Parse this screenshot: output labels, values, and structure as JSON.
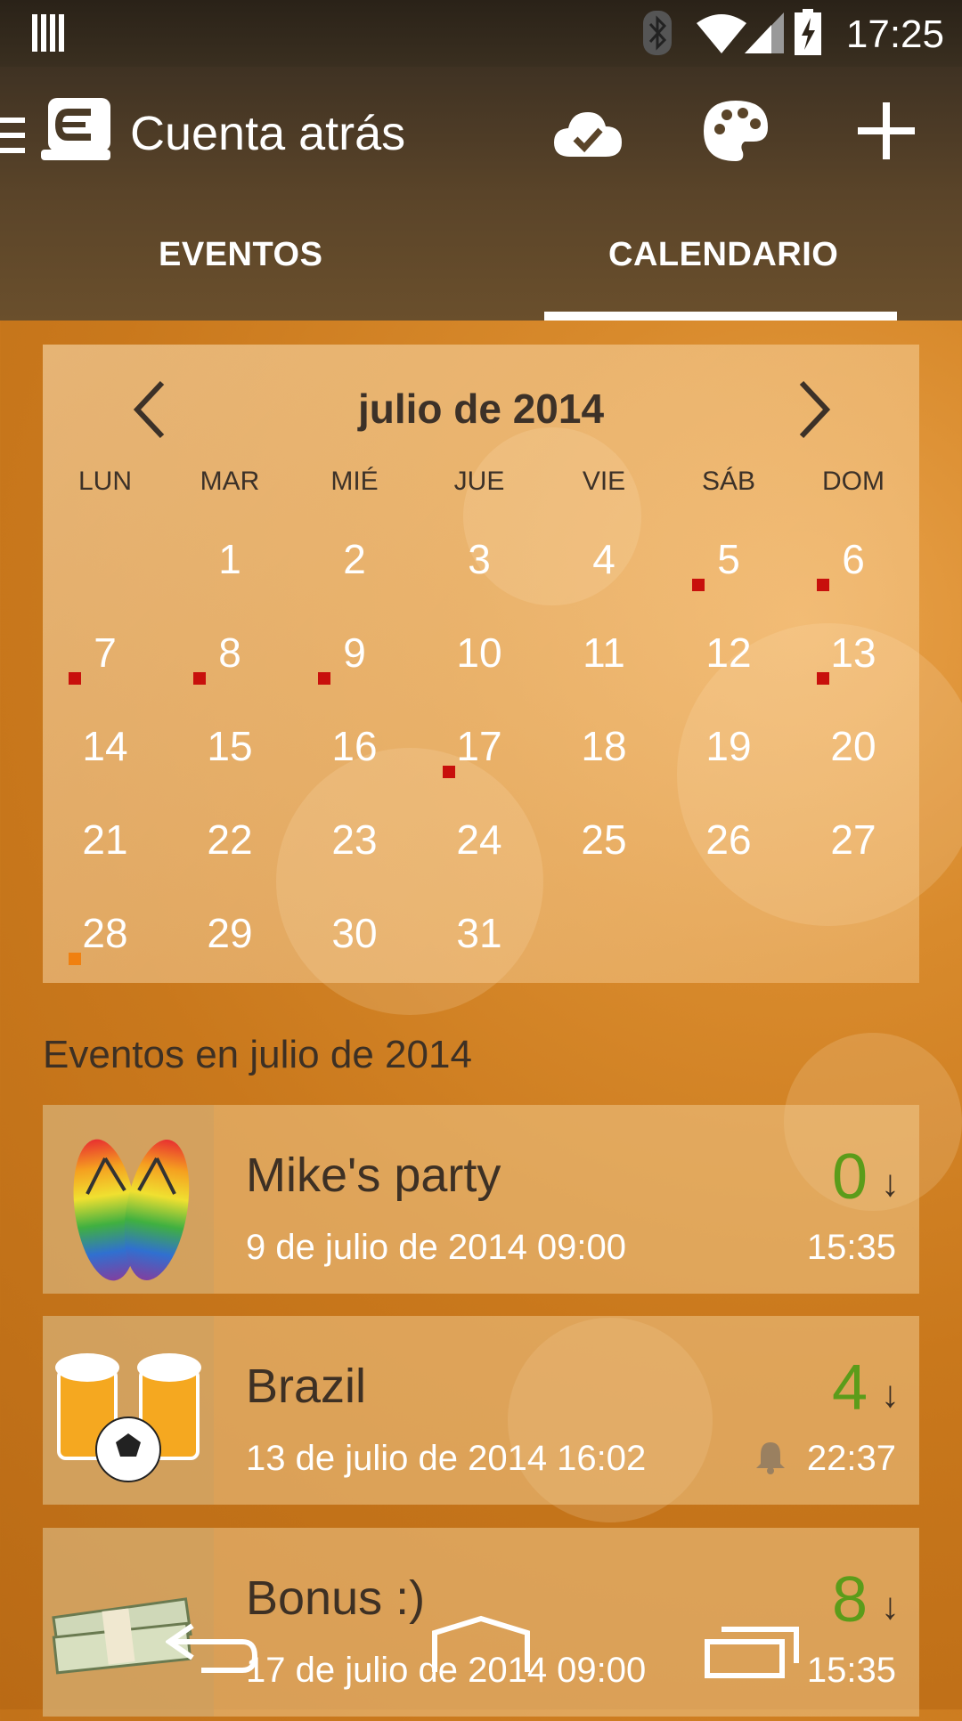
{
  "status": {
    "time": "17:25"
  },
  "app": {
    "title": "Cuenta atrás"
  },
  "tabs": [
    {
      "label": "EVENTOS"
    },
    {
      "label": "CALENDARIO"
    }
  ],
  "calendar": {
    "month_title": "julio de 2014",
    "weekdays": [
      "LUN",
      "MAR",
      "MIÉ",
      "JUE",
      "VIE",
      "SÁB",
      "DOM"
    ],
    "days": [
      "1",
      "2",
      "3",
      "4",
      "5",
      "6",
      "7",
      "8",
      "9",
      "10",
      "11",
      "12",
      "13",
      "14",
      "15",
      "16",
      "17",
      "18",
      "19",
      "20",
      "21",
      "22",
      "23",
      "24",
      "25",
      "26",
      "27",
      "28",
      "29",
      "30",
      "31"
    ]
  },
  "events_section": {
    "title": "Eventos en julio de 2014"
  },
  "events": [
    {
      "name": "Mike's party",
      "date": "9 de julio de 2014 09:00",
      "count": "0",
      "time": "15:35"
    },
    {
      "name": "Brazil",
      "date": "13 de julio de 2014 16:02",
      "count": "4",
      "time": "22:37"
    },
    {
      "name": "Bonus :)",
      "date": "17 de julio de 2014 09:00",
      "count": "8",
      "time": "15:35"
    }
  ],
  "colors": {
    "accent_green": "#5b9c1a",
    "marker_red": "#c8100c",
    "marker_orange": "#f08010"
  }
}
